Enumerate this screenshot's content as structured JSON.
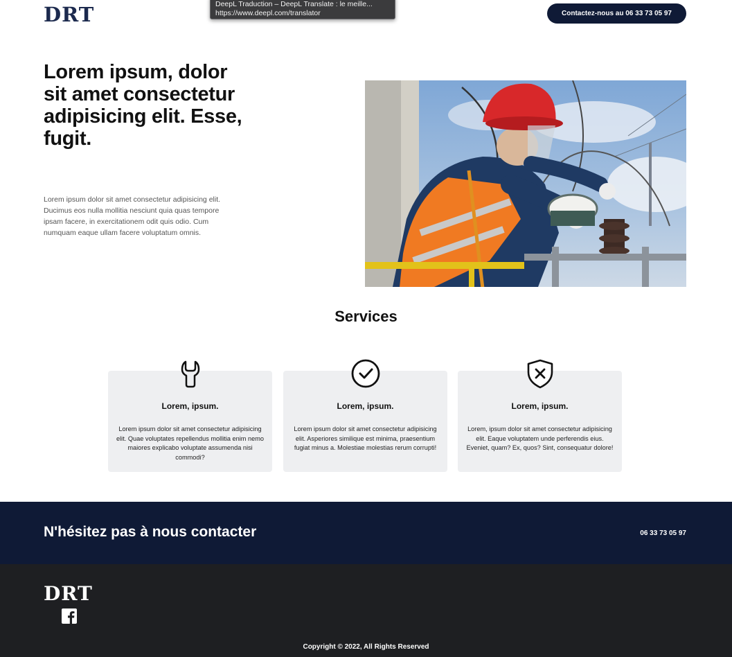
{
  "header": {
    "logo": "DRT",
    "contact_button": "Contactez-nous au 06 33 73 05 97"
  },
  "tooltip": {
    "title": "DeepL Traduction – DeepL Translate : le meille...",
    "url": "https://www.deepl.com/translator"
  },
  "hero": {
    "title": "Lorem ipsum, dolor sit amet consectetur adipisicing elit. Esse, fugit.",
    "text": "Lorem ipsum dolor sit amet consectetur adipisicing elit. Ducimus eos nulla mollitia nesciunt quia quas tempore ipsam facere, in exercitationem odit quis odio. Cum numquam eaque ullam facere voluptatum omnis."
  },
  "services": {
    "title": "Services",
    "cards": [
      {
        "icon": "wrench-icon",
        "title": "Lorem, ipsum.",
        "text": "Lorem ipsum dolor sit amet consectetur adipisicing elit. Quae voluptates repellendus mollitia enim nemo maiores explicabo voluptate assumenda nisi commodi?"
      },
      {
        "icon": "check-circle-icon",
        "title": "Lorem, ipsum.",
        "text": "Lorem ipsum dolor sit amet consectetur adipisicing elit. Asperiores similique est minima, praesentium fugiat minus a. Molestiae molestias rerum corrupti!"
      },
      {
        "icon": "shield-x-icon",
        "title": "Lorem, ipsum.",
        "text": "Lorem, ipsum dolor sit amet consectetur adipisicing elit. Eaque voluptatem unde perferendis eius. Eveniet, quam? Ex, quos? Sint, consequatur dolore!"
      }
    ]
  },
  "cta": {
    "title": "N'hésitez pas à nous contacter",
    "phone": "06 33 73 05 97"
  },
  "footer": {
    "logo": "DRT",
    "social_icon": "facebook-icon",
    "copyright": "Copyright © 2022, All Rights Reserved"
  },
  "colors": {
    "navy": "#0f1a36",
    "footer_bg": "#1e1f22",
    "card_bg": "#eeeff1"
  }
}
